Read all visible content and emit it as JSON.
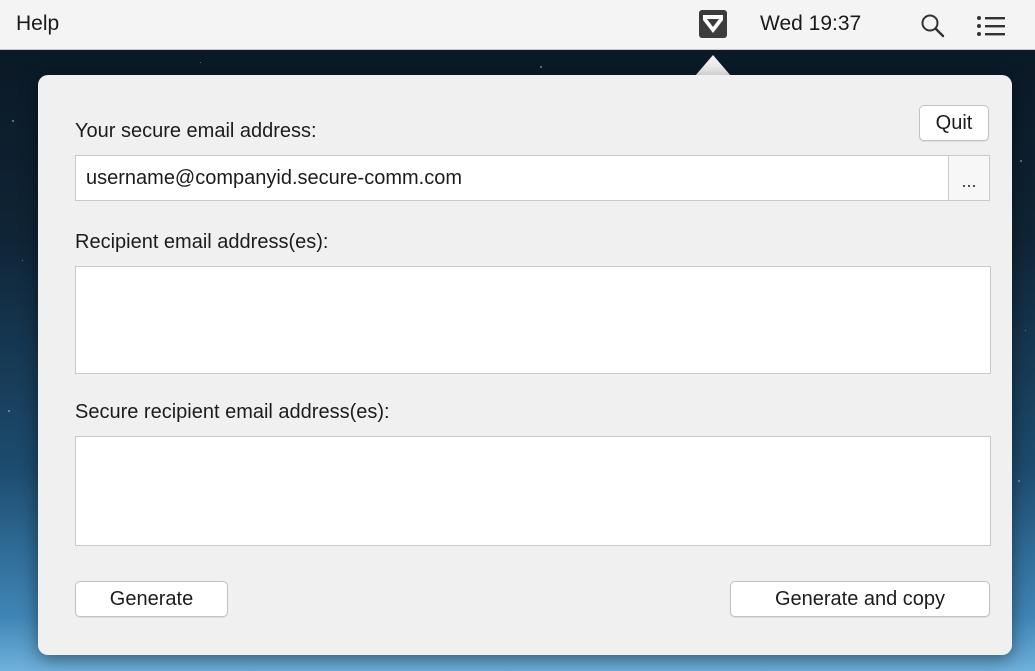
{
  "menubar": {
    "help_label": "Help",
    "clock": "Wed 19:37",
    "status_icon": "secure-mail-status-icon",
    "search_icon": "search-icon",
    "list_icon": "notification-list-icon"
  },
  "popover": {
    "quit_label": "Quit",
    "sender_label": "Your secure email address:",
    "sender_value": "username@companyid.secure-comm.com",
    "browse_label": "...",
    "recipients_label": "Recipient email address(es):",
    "recipients_value": "",
    "secure_recipients_label": "Secure recipient email address(es):",
    "secure_recipients_value": "",
    "generate_label": "Generate",
    "generate_copy_label": "Generate and copy"
  },
  "colors": {
    "menubar_bg": "#f4f4f4",
    "popover_bg": "#f0f0f0",
    "status_icon_bg": "#3c3c3c"
  }
}
